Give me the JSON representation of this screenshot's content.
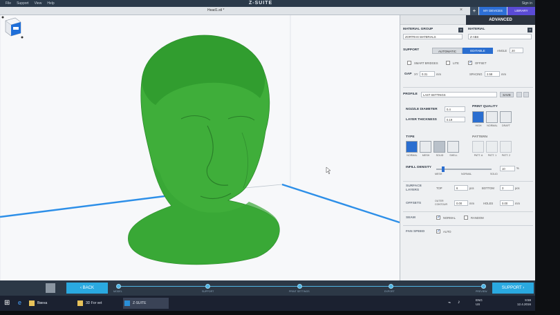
{
  "app": {
    "menu": [
      "File",
      "Support",
      "View",
      "Help"
    ],
    "title": "Z-SUITE",
    "signin": "Sign in"
  },
  "tabs": {
    "file": "Head1.stl *",
    "close": "×",
    "add": "+",
    "my_devices": "MY DEVICES",
    "library": "LIBRARY"
  },
  "panel": {
    "advanced": "ADVANCED",
    "material_group_label": "MATERIAL GROUP",
    "material_group_value": "ZORTRAX MATERIALS",
    "material_label": "MATERIAL",
    "material_value": "Z-ABS",
    "support_label": "SUPPORT",
    "support_auto": "AUTOMATIC",
    "support_editable": "EDITABLE",
    "angle_label": "ANGLE",
    "angle_value": "20",
    "smart_bridges": "SMART BRIDGES",
    "lite": "LITE",
    "offset": "OFFSET",
    "gap_label": "GAP",
    "gap_xy": "XY",
    "gap_value": "0.31",
    "mm": "mm",
    "spacing_label": "SPACING",
    "spacing_value": "2.58",
    "profile_label": "PROFILE",
    "profile_value": "LAST SETTINGS",
    "save": "SAVE",
    "nozzle_label": "NOZZLE DIAMETER",
    "nozzle_value": "0.4",
    "layer_label": "LAYER THICKNESS",
    "layer_value": "0.19",
    "print_quality_label": "PRINT QUALITY",
    "quality_options": [
      "HIGH",
      "NORMAL",
      "DRAFT"
    ],
    "type_label": "TYPE",
    "type_options": [
      "NORMAL",
      "MESH",
      "SOLID",
      "SHELL"
    ],
    "pattern_label": "PATTERN",
    "pattern_options": [
      "PATT. A",
      "PATT. 1",
      "PATT. 2"
    ],
    "infill_label": "INFILL DENSITY",
    "infill_value": "10",
    "infill_unit": "%",
    "infill_marks": [
      "MESH",
      "NORMAL",
      "SOLID"
    ],
    "surface_label": "SURFACE LAYERS",
    "top_label": "TOP",
    "top_value": "6",
    "bottom_label": "BOTTOM",
    "bottom_value": "3",
    "pcs": "pcs",
    "offsets_label": "OFFSETS",
    "outer_contour_label": "OUTER CONTOUR",
    "outer_value": "0.00",
    "holes_label": "HOLES",
    "holes_value": "0.00",
    "seam_label": "SEAM",
    "seam_normal": "NORMAL",
    "seam_random": "RANDOM",
    "fan_label": "FAN SPEED",
    "fan_auto": "AUTO"
  },
  "bottombar": {
    "back": "BACK",
    "support": "SUPPORT",
    "steps": [
      "MODEL",
      "SUPPORT",
      "PRINT SETTINGS",
      "EXPORT",
      "PREVIEW"
    ]
  },
  "taskbar": {
    "tasks": [
      "Ввена",
      "3D For vet",
      "Z-SUITE"
    ],
    "lang": "ENG",
    "lang_region": "US",
    "time": "9:59",
    "date": "12.4.2016"
  },
  "colors": {
    "model_green": "#3fae3a",
    "accent_blue": "#2a6ed0",
    "platform_blue": "#2d8fe8"
  }
}
